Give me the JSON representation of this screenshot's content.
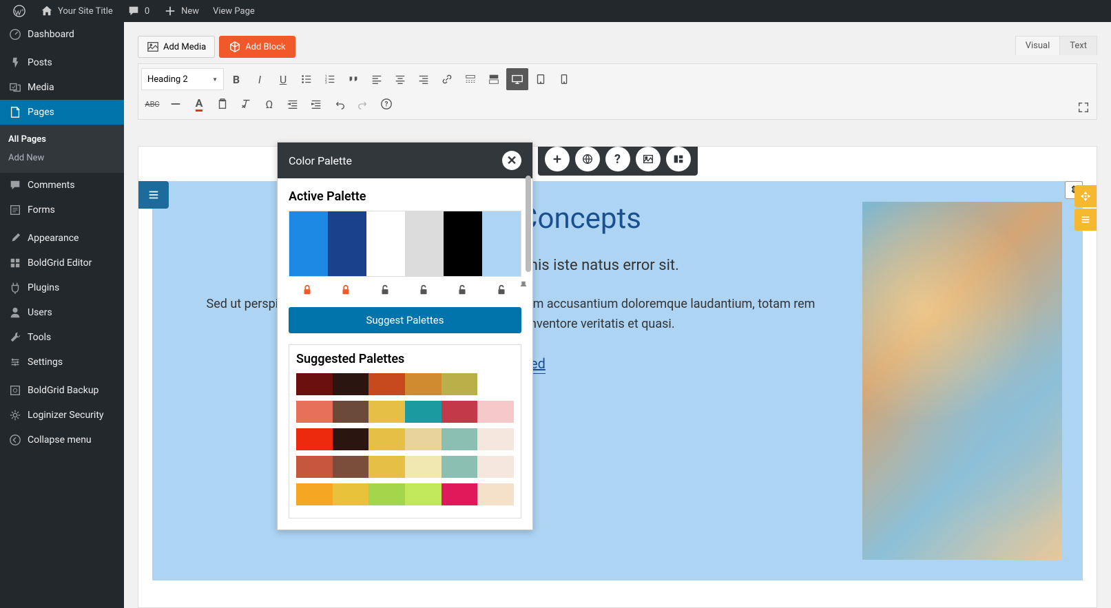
{
  "admin_bar": {
    "site_title": "Your Site Title",
    "comment_count": "0",
    "new": "New",
    "view_page": "View Page"
  },
  "sidebar": {
    "items": [
      {
        "icon": "dashboard",
        "label": "Dashboard"
      },
      {
        "icon": "pin",
        "label": "Posts"
      },
      {
        "icon": "media",
        "label": "Media"
      },
      {
        "icon": "page",
        "label": "Pages",
        "active": true
      },
      {
        "icon": "comment",
        "label": "Comments"
      },
      {
        "icon": "forms",
        "label": "Forms"
      },
      {
        "icon": "brush",
        "label": "Appearance"
      },
      {
        "icon": "boldgrid",
        "label": "BoldGrid Editor"
      },
      {
        "icon": "plugin",
        "label": "Plugins"
      },
      {
        "icon": "user",
        "label": "Users"
      },
      {
        "icon": "wrench",
        "label": "Tools"
      },
      {
        "icon": "settings",
        "label": "Settings"
      },
      {
        "icon": "backup",
        "label": "BoldGrid Backup"
      },
      {
        "icon": "gear",
        "label": "Loginizer Security"
      },
      {
        "icon": "collapse",
        "label": "Collapse menu"
      }
    ],
    "sub_items": [
      {
        "label": "All Pages",
        "current": true
      },
      {
        "label": "Add New"
      }
    ]
  },
  "editor": {
    "add_media": "Add Media",
    "add_block": "Add Block",
    "format_select": "Heading 2",
    "tabs": {
      "visual": "Visual",
      "text": "Text"
    }
  },
  "panel": {
    "title": "Color Palette",
    "active_title": "Active Palette",
    "active_colors": [
      "#1e88e5",
      "#1a418c",
      "#ffffff",
      "#dcdcdc",
      "#000000",
      "#aed4f4"
    ],
    "locks": [
      true,
      true,
      false,
      false,
      false,
      false
    ],
    "suggest_btn": "Suggest Palettes",
    "suggested_title": "Suggested Palettes",
    "suggested": [
      [
        "#6b0e0e",
        "#2b1510",
        "#c6481d",
        "#d08a30",
        "#b9b04a",
        "#ffffff"
      ],
      [
        "#e6705a",
        "#6b4a3a",
        "#e6c044",
        "#1b9ba0",
        "#c23a4a",
        "#f5c9c9"
      ],
      [
        "#ed2a0e",
        "#2b1510",
        "#e6c044",
        "#e8d49a",
        "#8abfb2",
        "#f5e6de"
      ],
      [
        "#c6563e",
        "#7a4e3a",
        "#e6c044",
        "#f0e8b0",
        "#8abfb2",
        "#f5e6de"
      ],
      [
        "#f5a623",
        "#e8c23a",
        "#a3d64a",
        "#c1e85a",
        "#e01a5a",
        "#f5e0c9"
      ]
    ]
  },
  "content": {
    "heading": "Innovative Concepts",
    "lead": "Sed ut perspiciatis unde omnis iste natus error sit.",
    "body": "Sed ut perspiciatis unde omnis iste natus error sit voluptatem accusantium doloremque laudantium, totam rem aperiam, eaque ipsa quae ab illo inventore veritatis et quasi.",
    "cta": "Get Started"
  }
}
